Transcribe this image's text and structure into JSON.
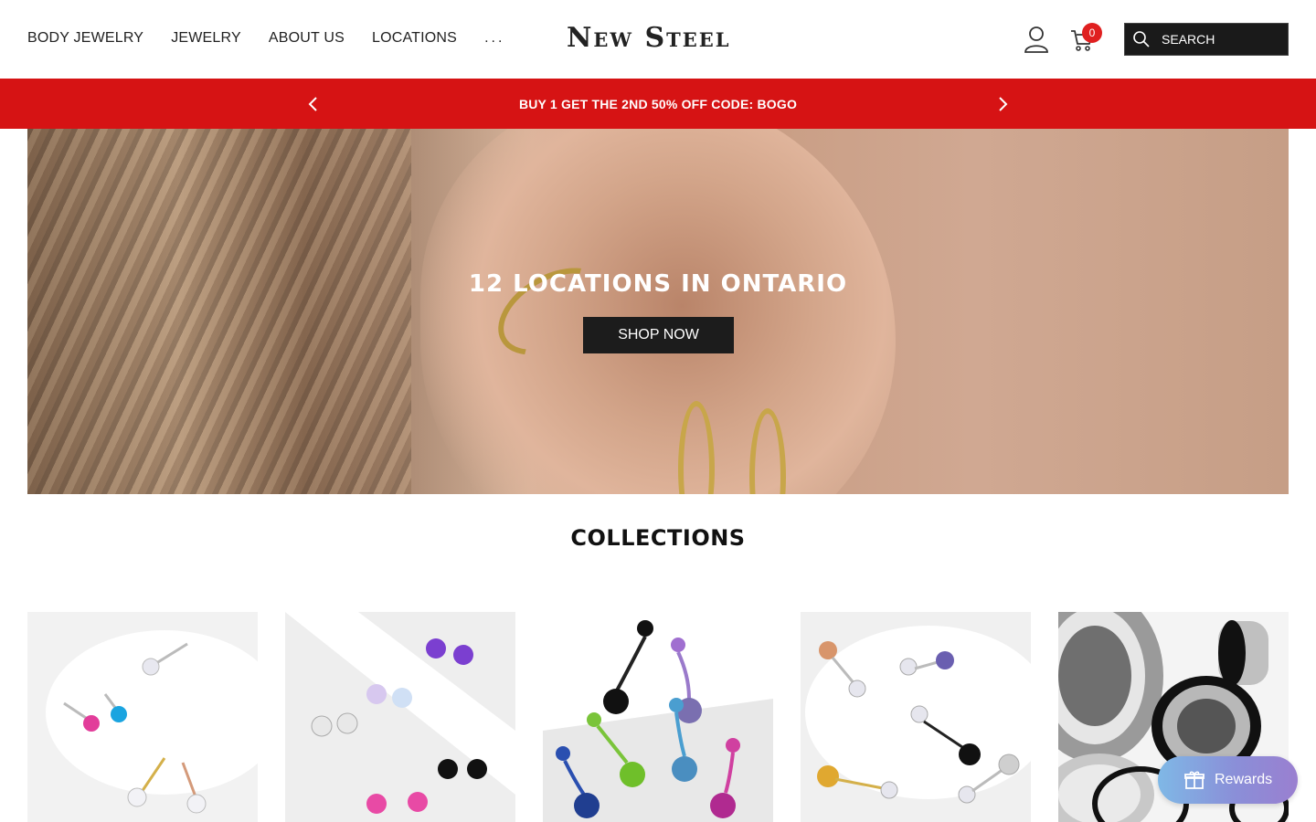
{
  "header": {
    "nav": [
      {
        "label": "BODY JEWELRY"
      },
      {
        "label": "JEWELRY"
      },
      {
        "label": "ABOUT US"
      },
      {
        "label": "LOCATIONS"
      },
      {
        "label": "..."
      }
    ],
    "logo": "New Steel",
    "cart_count": "0",
    "search_placeholder": "SEARCH"
  },
  "promo": {
    "text": "BUY 1 GET THE 2ND 50% OFF CODE: BOGO"
  },
  "hero": {
    "title": "12 LOCATIONS IN ONTARIO",
    "button": "SHOP NOW"
  },
  "collections": {
    "title": "COLLECTIONS"
  },
  "rewards": {
    "label": "Rewards"
  },
  "colors": {
    "promo_red": "#d61314",
    "button_dark": "#1c1c1c",
    "badge_red": "#e02020"
  }
}
